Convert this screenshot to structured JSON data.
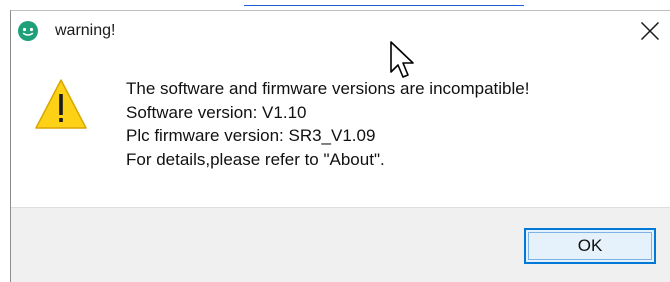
{
  "dialog": {
    "title": "warning!",
    "app_icon": "app-logo-icon",
    "close_icon": "close-icon",
    "warning_icon": "warning-triangle-icon",
    "message_lines": [
      "The software and firmware versions are incompatible!",
      "Software version: V1.10",
      "Plc firmware version: SR3_V1.09",
      "For details,please refer to \"About\"."
    ],
    "ok_label": "OK"
  },
  "colors": {
    "app_icon_bg": "#1fa07a",
    "warning_fill": "#fcd116",
    "ok_border": "#0078d7",
    "footer_bg": "#f0f0f0"
  }
}
